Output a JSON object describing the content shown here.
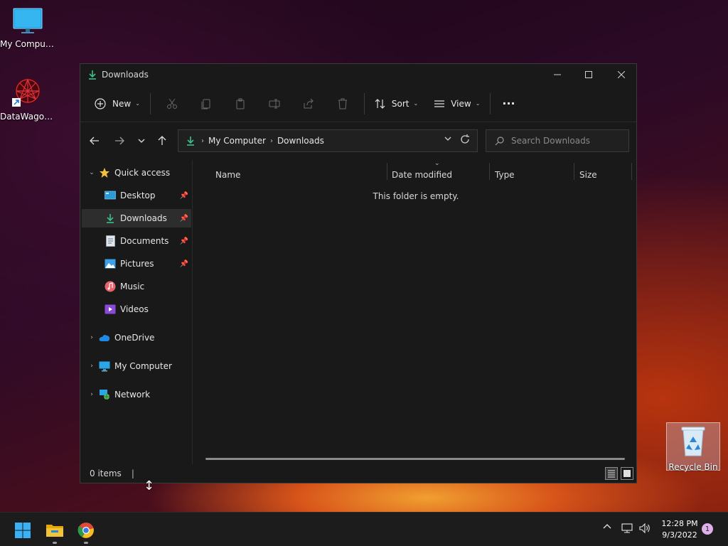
{
  "desktop": {
    "icons": [
      {
        "label": "My Computer"
      },
      {
        "label": "DataWagon..."
      },
      {
        "label": "Recycle Bin"
      }
    ]
  },
  "window": {
    "title": "Downloads",
    "toolbar": {
      "new_label": "New",
      "sort_label": "Sort",
      "view_label": "View",
      "more_label": "···"
    },
    "address": {
      "crumbs": [
        "My Computer",
        "Downloads"
      ]
    },
    "search": {
      "placeholder": "Search Downloads"
    },
    "sidebar": {
      "quick_access": "Quick access",
      "items": [
        {
          "label": "Desktop",
          "pinned": true
        },
        {
          "label": "Downloads",
          "pinned": true,
          "selected": true
        },
        {
          "label": "Documents",
          "pinned": true
        },
        {
          "label": "Pictures",
          "pinned": true
        },
        {
          "label": "Music",
          "pinned": false
        },
        {
          "label": "Videos",
          "pinned": false
        }
      ],
      "onedrive": "OneDrive",
      "my_computer": "My Computer",
      "network": "Network"
    },
    "columns": [
      "Name",
      "Date modified",
      "Type",
      "Size"
    ],
    "empty_message": "This folder is empty.",
    "status": "0 items"
  },
  "taskbar": {
    "time": "12:28 PM",
    "date": "9/3/2022",
    "notification_count": "1"
  },
  "colors": {
    "accent_download": "#3cc08c",
    "window_bg": "#191919",
    "taskbar_bg": "#1c1c1c",
    "folder_yellow": "#f2c23a"
  }
}
